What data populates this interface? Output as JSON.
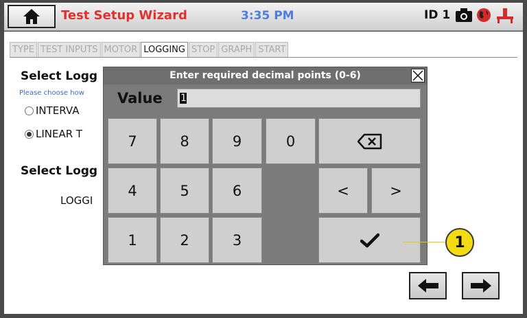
{
  "header": {
    "title": "Test Setup Wizard",
    "time": "3:35 PM",
    "id_label": "ID 1"
  },
  "tabs": [
    {
      "label": "TYPE",
      "active": false
    },
    {
      "label": "TEST INPUTS",
      "active": false
    },
    {
      "label": "MOTOR",
      "active": false
    },
    {
      "label": "LOGGING",
      "active": true
    },
    {
      "label": "STOP",
      "active": false
    },
    {
      "label": "GRAPH",
      "active": false
    },
    {
      "label": "START",
      "active": false
    }
  ],
  "logging": {
    "section1_title": "Select Logg",
    "hint": "Please choose how",
    "option_interval": "INTERVA",
    "option_linear": "LINEAR T",
    "section2_title": "Select Logg",
    "logging_value": "LOGGI"
  },
  "dialog": {
    "title": "Enter required decimal points (0-6)",
    "value_label": "Value",
    "value": "1",
    "keys": {
      "k7": "7",
      "k8": "8",
      "k9": "9",
      "k0": "0",
      "k4": "4",
      "k5": "5",
      "k6": "6",
      "k1": "1",
      "k2": "2",
      "k3": "3",
      "left": "<",
      "right": ">"
    }
  },
  "callout": "1",
  "colors": {
    "title_red": "#e0312f",
    "clock_blue": "#4e7ee0",
    "callout_yellow": "#f4dc14"
  }
}
